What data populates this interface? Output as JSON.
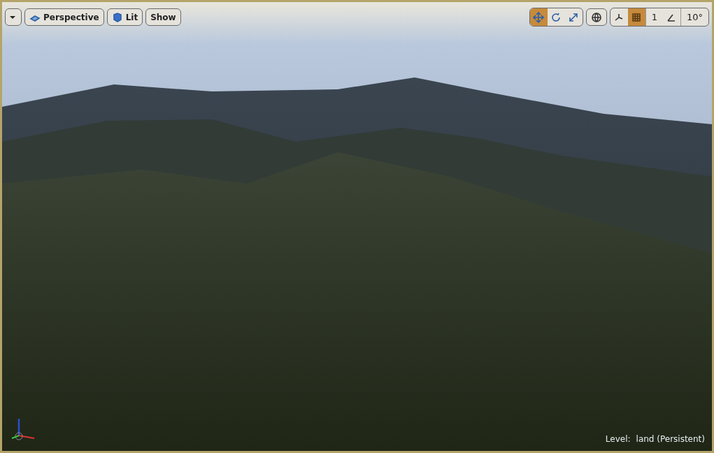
{
  "viewport_toolbar": {
    "left": [
      {
        "kind": "menu"
      },
      {
        "kind": "view",
        "label": "Perspective"
      },
      {
        "kind": "mode",
        "label": "Lit"
      },
      {
        "kind": "plain",
        "label": "Show"
      }
    ],
    "transform_modes": [
      {
        "kind": "move",
        "selected": true
      },
      {
        "kind": "rotate",
        "selected": false
      },
      {
        "kind": "scale",
        "selected": false
      }
    ],
    "grid_snap": {
      "on": true,
      "value": "1"
    },
    "rotation_snap": {
      "on": false,
      "value": "10°"
    }
  },
  "status": {
    "label": "Level:",
    "value": "land (Persistent)"
  }
}
